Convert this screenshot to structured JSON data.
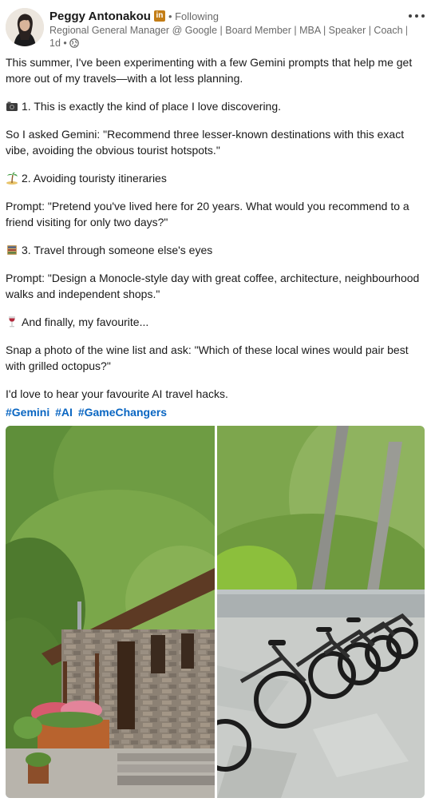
{
  "author": {
    "name": "Peggy Antonakou",
    "badge": "in",
    "following": "• Following",
    "headline": "Regional General Manager @ Google | Board Member | MBA | Speaker | Coach || ...",
    "time": "1d •"
  },
  "post": {
    "paragraphs": [
      "This summer, I've been experimenting with a few Gemini prompts that help me get more out of my travels—with a lot less planning.",
      "1. This is exactly the kind of place I love discovering.",
      "So I asked Gemini: \"Recommend three lesser-known destinations with this exact vibe, avoiding the obvious tourist hotspots.\"",
      "2. Avoiding touristy itineraries",
      "Prompt: \"Pretend you've lived here for 20 years. What would you recommend to a friend visiting for only two days?\"",
      "3. Travel through someone else's eyes",
      "Prompt: \"Design a Monocle-style day with great coffee, architecture, neighbourhood walks and independent shops.\"",
      "And finally, my favourite...",
      "Snap a photo of the wine list and ask: \"Which of these local wines would pair best with grilled octopus?\"",
      "I'd love to hear your favourite AI travel hacks."
    ],
    "hashtags": [
      "#Gemini",
      "#AI",
      "#GameChangers"
    ]
  },
  "icons": {
    "p1": "camera-icon",
    "p2": "palm-island-icon",
    "p3": "book-icon",
    "p4": "wine-glass-icon",
    "privacy": "globe-icon",
    "menu": "more-icon"
  },
  "colors": {
    "accent": "#0a66c2",
    "badge": "#c37d16",
    "secondary_text": "rgba(0,0,0,0.6)"
  }
}
